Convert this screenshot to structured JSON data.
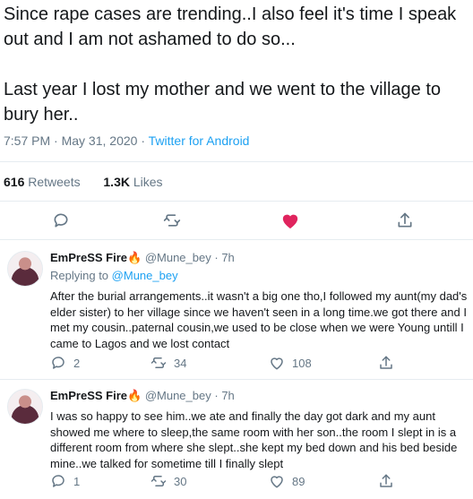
{
  "tweet": {
    "paragraph_1": "Since rape cases are trending..I also feel it's time I speak out and I am not ashamed to do so...",
    "paragraph_2": "Last year I lost my mother and we went to the village to bury her..",
    "time": "7:57 PM",
    "sep": "·",
    "date": "May 31, 2020",
    "source": "Twitter for Android",
    "retweets_count": "616",
    "retweets_label": "Retweets",
    "likes_count": "1.3K",
    "likes_label": "Likes",
    "liked_color": "#e0245e"
  },
  "replies": [
    {
      "name": "EmPreSS Fire",
      "emoji": "🔥",
      "handle": "@Mune_bey",
      "sep": "·",
      "time": "7h",
      "replying_label": "Replying to",
      "replying_to": "@Mune_bey",
      "text": "After the burial arrangements..it wasn't a big one tho,I followed my aunt(my dad's elder sister) to her village since we haven't seen in a long time.we got there and I met my cousin..paternal cousin,we used to be close when we were Young untill I came to Lagos and we lost contact",
      "reply_count": "2",
      "retweet_count": "34",
      "like_count": "108"
    },
    {
      "name": "EmPreSS Fire",
      "emoji": "🔥",
      "handle": "@Mune_bey",
      "sep": "·",
      "time": "7h",
      "text": "I was so happy to see him..we ate and finally the day got dark and my aunt showed me where to sleep,the same room with her son..the room I slept in is a different room from where she slept..she kept my bed down and his bed beside mine..we talked for sometime till I finally slept",
      "reply_count": "1",
      "retweet_count": "30",
      "like_count": "89"
    }
  ]
}
